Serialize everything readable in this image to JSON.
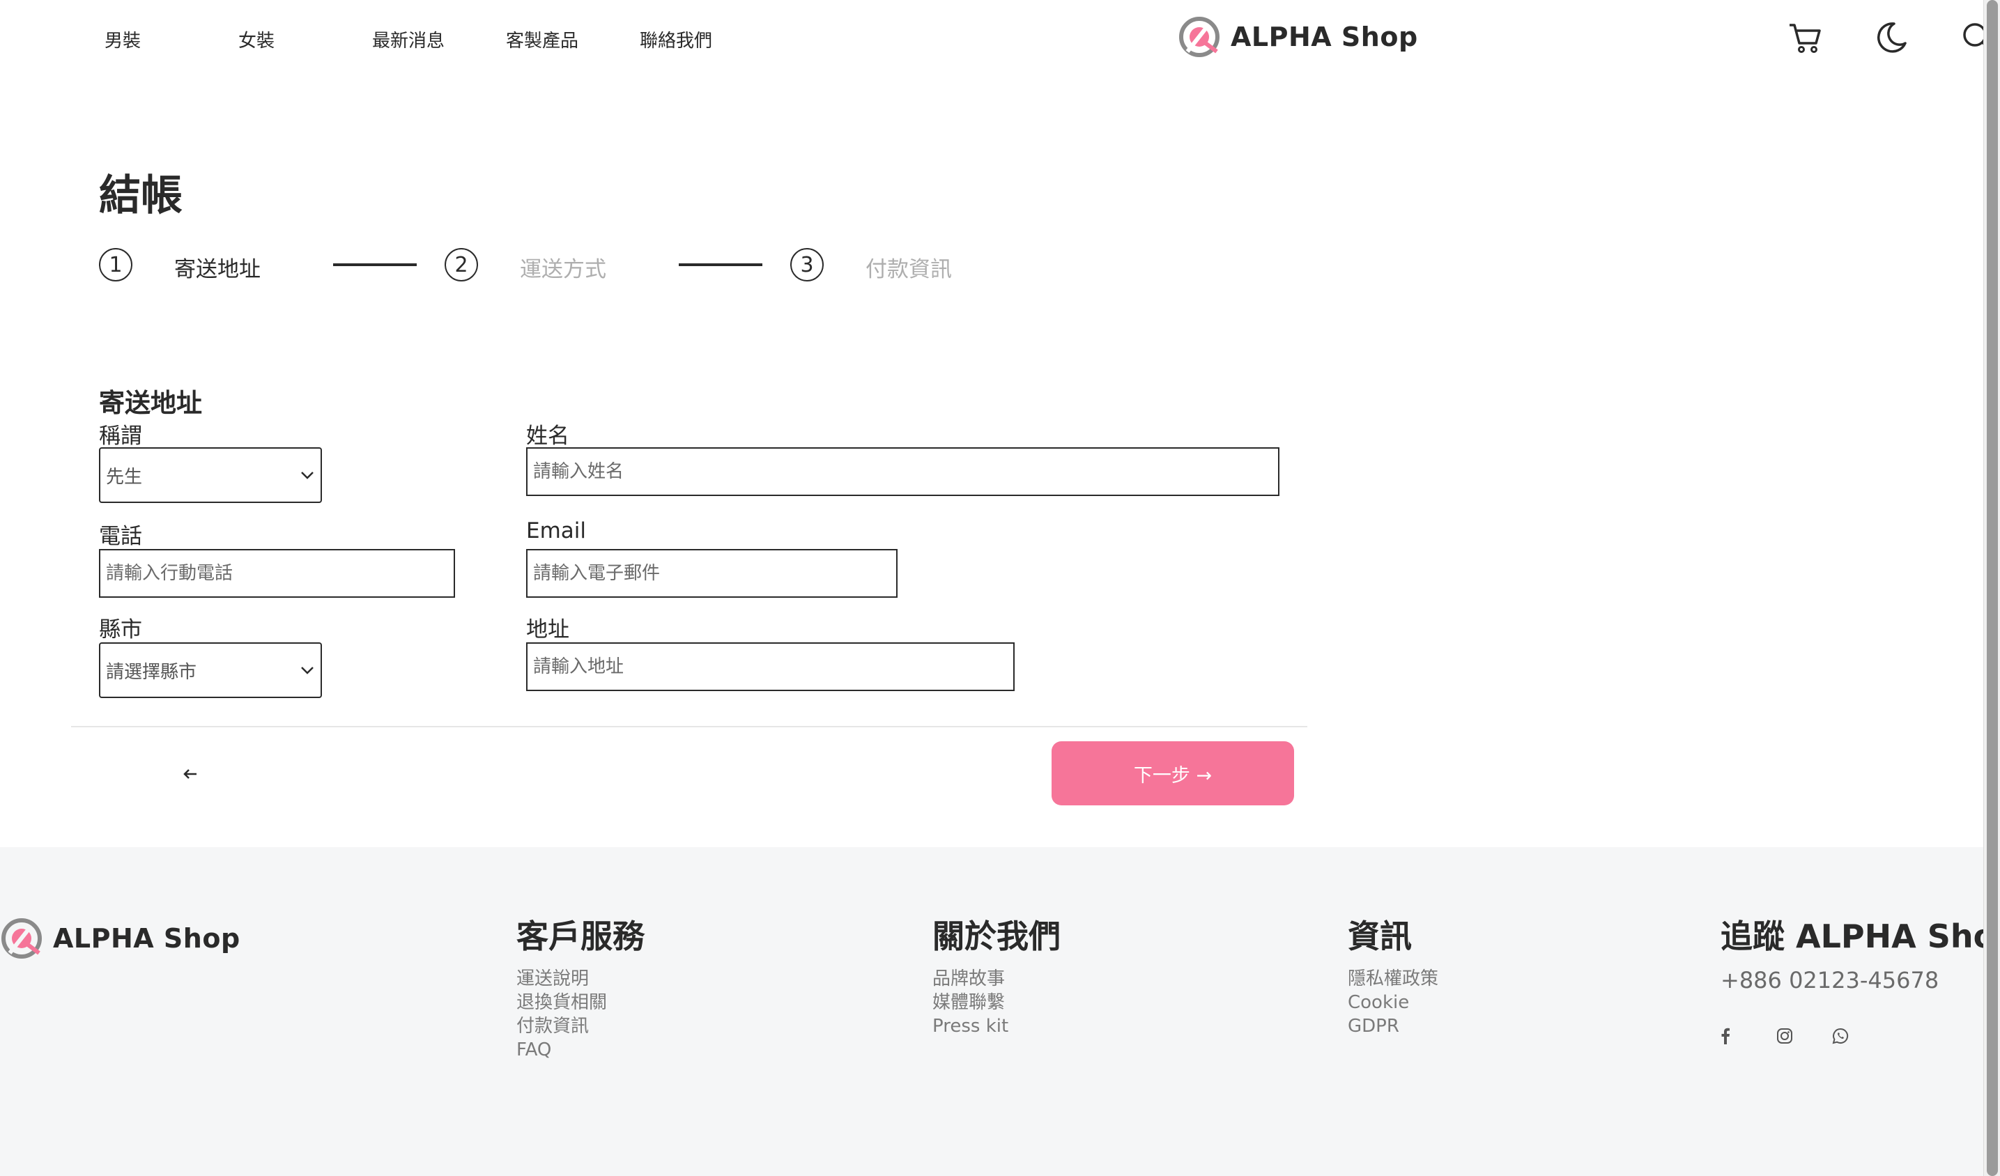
{
  "header": {
    "nav": [
      "男裝",
      "女裝",
      "最新消息",
      "客製產品",
      "聯絡我們"
    ],
    "brand": "ALPHA Shop",
    "icons": [
      "cart-icon",
      "moon-icon",
      "search-icon"
    ]
  },
  "page": {
    "title": "結帳",
    "steps": [
      {
        "number": "1",
        "label": "寄送地址",
        "active": true
      },
      {
        "number": "2",
        "label": "運送方式",
        "active": false
      },
      {
        "number": "3",
        "label": "付款資訊",
        "active": false
      }
    ]
  },
  "form": {
    "section_title": "寄送地址",
    "salutation": {
      "label": "稱謂",
      "value": "先生"
    },
    "name": {
      "label": "姓名",
      "placeholder": "請輸入姓名"
    },
    "phone": {
      "label": "電話",
      "placeholder": "請輸入行動電話"
    },
    "email": {
      "label": "Email",
      "placeholder": "請輸入電子郵件"
    },
    "city": {
      "label": "縣市",
      "value": "請選擇縣市"
    },
    "address": {
      "label": "地址",
      "placeholder": "請輸入地址"
    }
  },
  "actions": {
    "back_icon": "arrow-left-icon",
    "next_label": "下一步 →"
  },
  "footer": {
    "brand": "ALPHA Shop",
    "columns": [
      {
        "title": "客戶服務",
        "links": [
          "運送說明",
          "退換貨相關",
          "付款資訊",
          "FAQ"
        ]
      },
      {
        "title": "關於我們",
        "links": [
          "品牌故事",
          "媒體聯繫",
          "Press kit"
        ]
      },
      {
        "title": "資訊",
        "links": [
          "隱私權政策",
          "Cookie",
          "GDPR"
        ]
      }
    ],
    "follow": {
      "title": "追蹤 ALPHA Shop",
      "phone": "+886 02123-45678",
      "social": [
        "facebook-icon",
        "instagram-icon",
        "whatsapp-icon"
      ]
    }
  },
  "colors": {
    "accent": "#f67599",
    "text": "#2a2a2a",
    "muted": "#aeaeae",
    "footer_bg": "#f5f6f7"
  }
}
